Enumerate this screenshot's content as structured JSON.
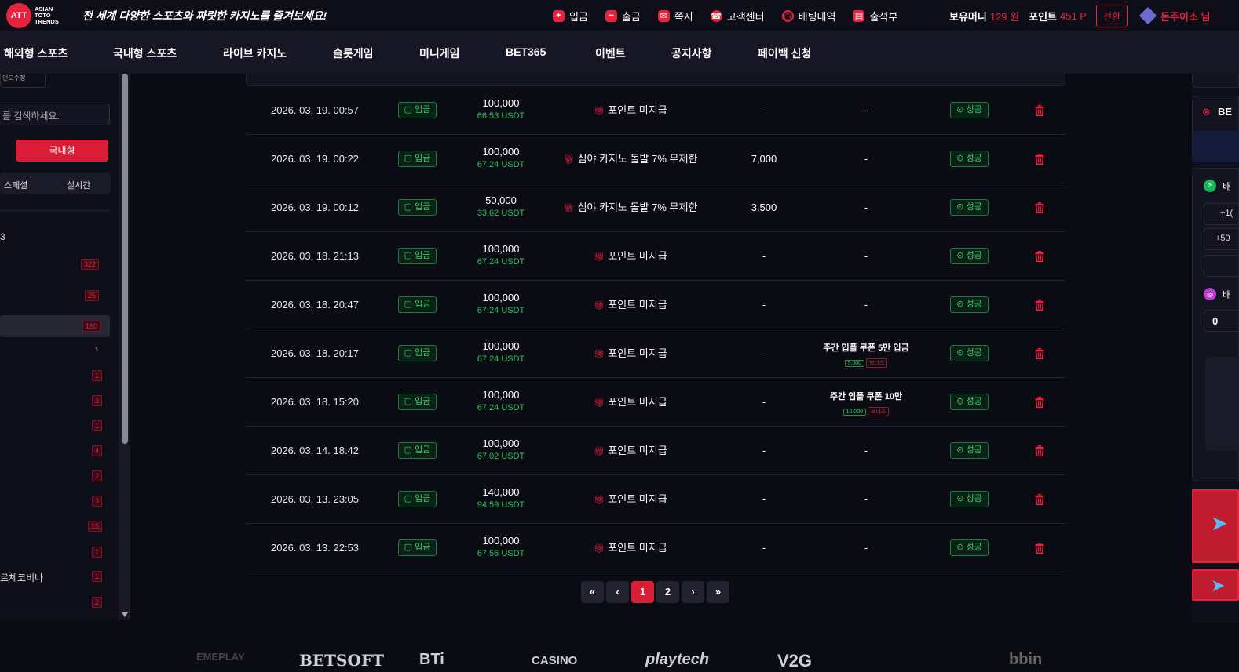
{
  "header": {
    "logo_mark": "ATT",
    "logo_lines": [
      "ASIAN",
      "TOTO",
      "TRENDS"
    ],
    "slogan": "전 세계 다양한 스포츠와 짜릿한 카지노를 즐겨보세요!",
    "nav": [
      {
        "label": "입금",
        "icon": "deposit-icon"
      },
      {
        "label": "출금",
        "icon": "withdraw-icon"
      },
      {
        "label": "쪽지",
        "icon": "mail-icon"
      },
      {
        "label": "고객센터",
        "icon": "headset-icon"
      },
      {
        "label": "배팅내역",
        "icon": "history-icon"
      },
      {
        "label": "출석부",
        "icon": "calendar-icon"
      }
    ],
    "money_label": "보유머니",
    "money_value": "129 원",
    "point_label": "포인트",
    "point_value": "451 P",
    "switch_label": "전환",
    "username": "돈주이소 님"
  },
  "main_nav": [
    "해외형 스포츠",
    "국내형 스포츠",
    "라이브 카지노",
    "슬롯게임",
    "미니게임",
    "BET365",
    "이벤트",
    "공지사항",
    "페이백 신청"
  ],
  "sidebar": {
    "top_tab": "인모수정",
    "search_placeholder": "를 검색하세요.",
    "domestic_button": "국내형",
    "tab_special": "스페셜",
    "tab_live": "실시간",
    "section_marker": "3",
    "counts": [
      "322",
      "25",
      "160",
      "",
      "1",
      "3",
      "1",
      "4",
      "2",
      "3",
      "15",
      "1",
      "1",
      "2"
    ],
    "named_item": "르체코비나"
  },
  "rows": [
    {
      "date": "2026. 03. 19. 00:57",
      "type": "입금",
      "amount": "100,000",
      "usdt": "66.53 USDT",
      "promo": "포인트 미지급",
      "point": "-",
      "coupon": "-",
      "coupon_amount": "",
      "coupon_tag": "",
      "status": "성공"
    },
    {
      "date": "2026. 03. 19. 00:22",
      "type": "입금",
      "amount": "100,000",
      "usdt": "67.24 USDT",
      "promo": "심야 카지노 돌발 7% 무제한",
      "point": "7,000",
      "coupon": "-",
      "coupon_amount": "",
      "coupon_tag": "",
      "status": "성공"
    },
    {
      "date": "2026. 03. 19. 00:12",
      "type": "입금",
      "amount": "50,000",
      "usdt": "33.62 USDT",
      "promo": "심야 카지노 돌발 7% 무제한",
      "point": "3,500",
      "coupon": "-",
      "coupon_amount": "",
      "coupon_tag": "",
      "status": "성공"
    },
    {
      "date": "2026. 03. 18. 21:13",
      "type": "입금",
      "amount": "100,000",
      "usdt": "67.24 USDT",
      "promo": "포인트 미지급",
      "point": "-",
      "coupon": "-",
      "coupon_amount": "",
      "coupon_tag": "",
      "status": "성공"
    },
    {
      "date": "2026. 03. 18. 20:47",
      "type": "입금",
      "amount": "100,000",
      "usdt": "67.24 USDT",
      "promo": "포인트 미지급",
      "point": "-",
      "coupon": "-",
      "coupon_amount": "",
      "coupon_tag": "",
      "status": "성공"
    },
    {
      "date": "2026. 03. 18. 20:17",
      "type": "입금",
      "amount": "100,000",
      "usdt": "67.24 USDT",
      "promo": "포인트 미지급",
      "point": "-",
      "coupon": "주간 입플 쿠폰 5만 입금",
      "coupon_amount": "5,000",
      "coupon_tag": "보너스",
      "status": "성공"
    },
    {
      "date": "2026. 03. 18. 15:20",
      "type": "입금",
      "amount": "100,000",
      "usdt": "67.24 USDT",
      "promo": "포인트 미지급",
      "point": "-",
      "coupon": "주간 입플 쿠폰 10만",
      "coupon_amount": "10,000",
      "coupon_tag": "보너스",
      "status": "성공"
    },
    {
      "date": "2026. 03. 14. 18:42",
      "type": "입금",
      "amount": "100,000",
      "usdt": "67.02 USDT",
      "promo": "포인트 미지급",
      "point": "-",
      "coupon": "-",
      "coupon_amount": "",
      "coupon_tag": "",
      "status": "성공"
    },
    {
      "date": "2026. 03. 13. 23:05",
      "type": "입금",
      "amount": "140,000",
      "usdt": "94.59 USDT",
      "promo": "포인트 미지급",
      "point": "-",
      "coupon": "-",
      "coupon_amount": "",
      "coupon_tag": "",
      "status": "성공"
    },
    {
      "date": "2026. 03. 13. 22:53",
      "type": "입금",
      "amount": "100,000",
      "usdt": "67.56 USDT",
      "promo": "포인트 미지급",
      "point": "-",
      "coupon": "-",
      "coupon_amount": "",
      "coupon_tag": "",
      "status": "성공"
    }
  ],
  "pager": {
    "first": "«",
    "prev": "‹",
    "pages": [
      "1",
      "2"
    ],
    "current": "1",
    "next": "›",
    "last": "»"
  },
  "brands": [
    "EMEPLAY",
    "BETSOFT",
    "BTi",
    "CASINO",
    "playtech",
    "V2G",
    "",
    "bbin"
  ],
  "right_panel": {
    "label_be": "BE",
    "label_bet": "배",
    "plus_1": "+1(",
    "plus_50": "+50",
    "zero": "0",
    "label_bet2": "배"
  },
  "colors": {
    "accent": "#e8213d",
    "success": "#2bd06a",
    "bg": "#0b0b14"
  }
}
